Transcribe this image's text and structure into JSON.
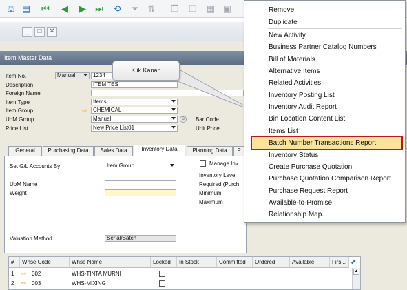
{
  "toolbar": {
    "icons": [
      {
        "name": "binoculars-icon",
        "glyph": "⛫",
        "tone": "blue"
      },
      {
        "name": "form-icon",
        "glyph": "▤",
        "tone": "blue"
      },
      {
        "name": "first-record-icon",
        "glyph": "⏮",
        "tone": "green"
      },
      {
        "name": "previous-record-icon",
        "glyph": "◀",
        "tone": "green"
      },
      {
        "name": "next-record-icon",
        "glyph": "▶",
        "tone": "green"
      },
      {
        "name": "last-record-icon",
        "glyph": "⏭",
        "tone": "green"
      },
      {
        "name": "refresh-icon",
        "glyph": "⟲",
        "tone": "blue"
      },
      {
        "name": "filter-icon",
        "glyph": "⏷",
        "tone": "gray"
      },
      {
        "name": "sort-icon",
        "glyph": "⇅",
        "tone": "gray"
      },
      {
        "name": "base-document-icon",
        "glyph": "❐",
        "tone": "gray"
      },
      {
        "name": "target-document-icon",
        "glyph": "❏",
        "tone": "gray"
      },
      {
        "name": "journal-icon",
        "glyph": "▦",
        "tone": "gray"
      },
      {
        "name": "layout-icon",
        "glyph": "▣",
        "tone": "gray"
      }
    ]
  },
  "window": {
    "title": "Item Master Data",
    "controls": {
      "minimize": "_",
      "maximize": "□",
      "close": "✕"
    }
  },
  "header": {
    "item_no_label": "Item No.",
    "item_no_series": "Manual",
    "item_no_value": "1234",
    "description_label": "Description",
    "description_value": "ITEM TES",
    "foreign_name_label": "Foreign Name",
    "item_type_label": "Item Type",
    "item_type_value": "Items",
    "item_group_label": "Item Group",
    "item_group_value": "CHEMICAL",
    "uom_group_label": "UoM Group",
    "uom_group_value": "Manual",
    "price_list_label": "Price List",
    "price_list_value": "New Price List01",
    "bar_code_label": "Bar Code",
    "unit_price_label": "Unit Price"
  },
  "tabs": [
    "General",
    "Purchasing Data",
    "Sales Data",
    "Inventory Data",
    "Planning Data",
    "P"
  ],
  "inventory": {
    "gl_label": "Set G/L Accounts By",
    "gl_value": "Item Group",
    "manage_inv_label": "Manage Inv",
    "inventory_level_label": "Inventory Level",
    "required_label": "Required (Purch",
    "minimum_label": "Minimum",
    "maximum_label": "Maximum",
    "uom_name_label": "UoM Name",
    "weight_label": "Weight",
    "valuation_label": "Valuation Method",
    "valuation_value": "Serial/Batch"
  },
  "warehouse_table": {
    "columns": [
      "#",
      "Whse Code",
      "Whse Name",
      "Locked",
      "In Stock",
      "Committed",
      "Ordered",
      "Available",
      "Firs..."
    ],
    "rows": [
      {
        "num": "1",
        "code": "002",
        "name": "WHS-TINTA MURNI"
      },
      {
        "num": "2",
        "code": "003",
        "name": "WHS-MIXING"
      }
    ]
  },
  "callout": {
    "text": "Klik Kanan"
  },
  "context_menu": {
    "items": [
      "Remove",
      "Duplicate",
      "New Activity",
      "Business Partner Catalog Numbers",
      "Bill of Materials",
      "Alternative Items",
      "Related Activities",
      "Inventory Posting List",
      "Inventory Audit Report",
      "Bin Location Content List",
      "Items List",
      "Batch Number Transactions Report",
      "Inventory Status",
      "Create Purchase Quotation",
      "Purchase Quotation Comparison Report",
      "Purchase Request Report",
      "Available-to-Promise",
      "Relationship Map..."
    ],
    "highlighted": "Batch Number Transactions Report"
  },
  "colors": {
    "highlight_fill": "#fbe39c",
    "highlight_border": "#c2161b",
    "title_bar": "#6b7b91"
  }
}
